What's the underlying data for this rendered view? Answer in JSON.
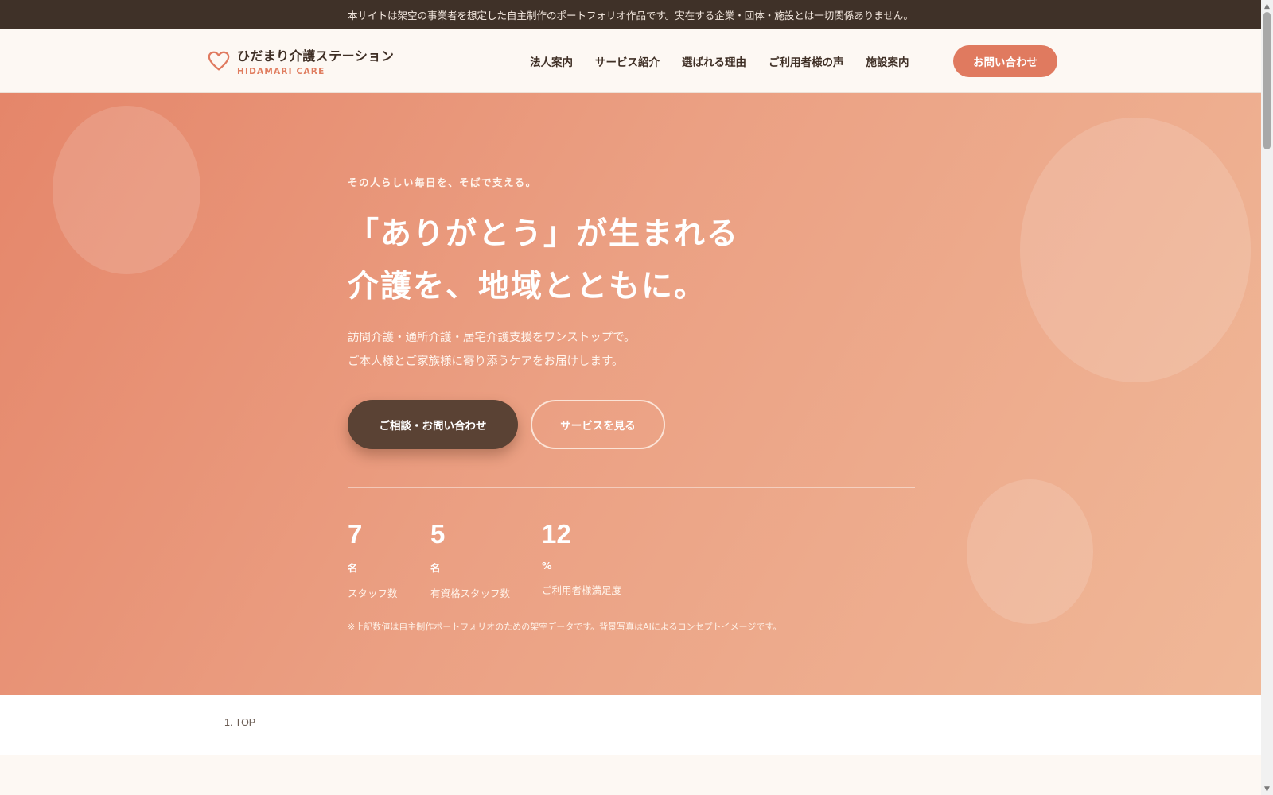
{
  "notice": {
    "text": "本サイトは架空の事業者を想定した自主制作のポートフォリオ作品です。実在する企業・団体・施設とは一切関係ありません。"
  },
  "header": {
    "brand_name": "ひだまり介護ステーション",
    "brand_sub": "HIDAMARI CARE",
    "brand_icon": "heart-icon",
    "nav": [
      {
        "label": "法人案内"
      },
      {
        "label": "サービス紹介"
      },
      {
        "label": "選ばれる理由"
      },
      {
        "label": "ご利用者様の声"
      },
      {
        "label": "施設案内"
      }
    ],
    "cta_label": "お問い合わせ"
  },
  "hero": {
    "tagline": "その人らしい毎日を、そばで支える。",
    "headline_line1": "「ありがとう」が生まれる",
    "headline_line2": "介護を、地域とともに。",
    "lead_line1": "訪問介護・通所介護・居宅介護支援をワンストップで。",
    "lead_line2": "ご本人様とご家族様に寄り添うケアをお届けします。",
    "primary_button": "ご相談・お問い合わせ",
    "secondary_button": "サービスを見る",
    "stats": [
      {
        "value": "7",
        "unit": "名",
        "label": "スタッフ数"
      },
      {
        "value": "5",
        "unit": "名",
        "label": "有資格スタッフ数"
      },
      {
        "value": "12",
        "unit": "%",
        "label": "ご利用者様満足度"
      }
    ],
    "note": "※上記数値は自主制作ポートフォリオのための架空データです。背景写真はAIによるコンセプトイメージです。"
  },
  "breadcrumb": {
    "item": "1. TOP"
  },
  "colors": {
    "accent": "#e07a5f",
    "dark": "#3f3128",
    "button_dark": "#5a4234",
    "header_bg": "#fdf8f3"
  }
}
